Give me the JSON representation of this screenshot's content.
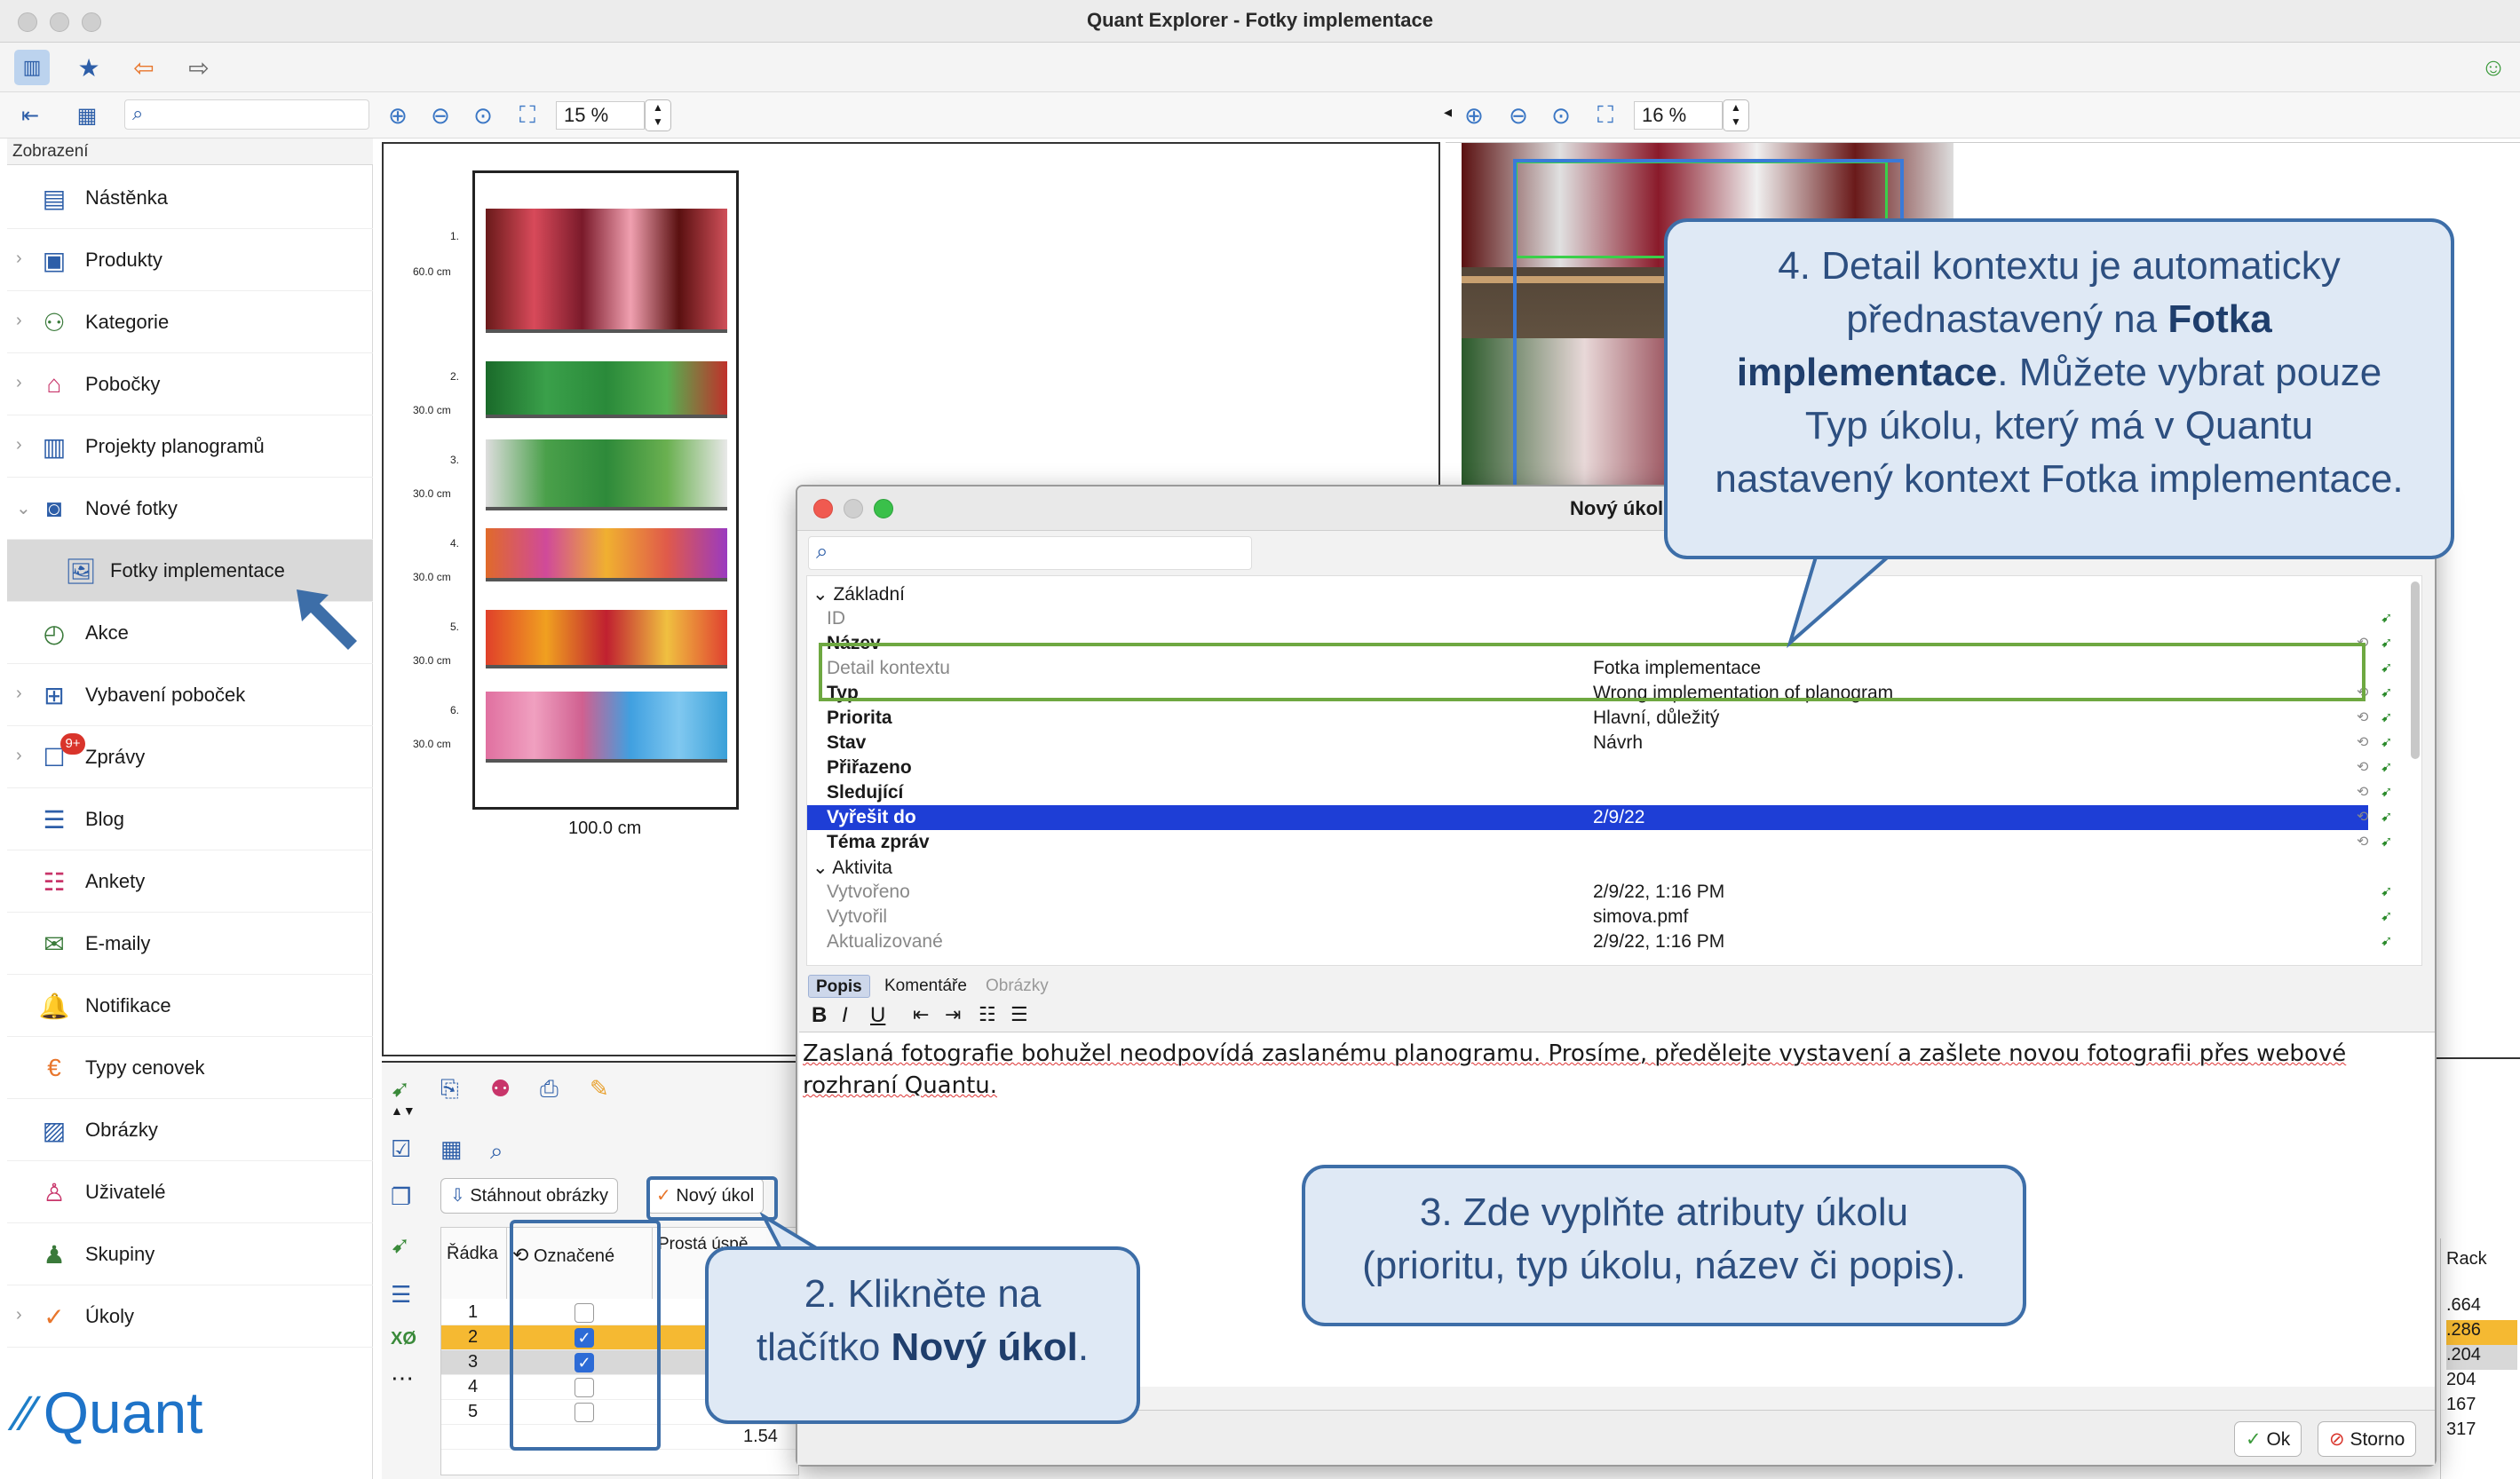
{
  "window": {
    "title": "Quant Explorer - Fotky implementace"
  },
  "left_toolbar": {
    "zoom": "15 %"
  },
  "right_toolbar": {
    "zoom": "16 %"
  },
  "sidebar": {
    "header": "Zobrazení",
    "items": [
      {
        "label": "Nástěnka",
        "icon": "dashboard-icon"
      },
      {
        "label": "Produkty",
        "icon": "product-icon"
      },
      {
        "label": "Kategorie",
        "icon": "category-tree-icon"
      },
      {
        "label": "Pobočky",
        "icon": "store-icon"
      },
      {
        "label": "Projekty planogramů",
        "icon": "planogram-icon"
      },
      {
        "label": "Nové fotky",
        "icon": "camera-icon"
      },
      {
        "label": "Fotky implementace",
        "icon": "photo-icon"
      },
      {
        "label": "Akce",
        "icon": "clock-icon"
      },
      {
        "label": "Vybavení poboček",
        "icon": "equipment-icon"
      },
      {
        "label": "Zprávy",
        "icon": "messages-icon",
        "badge": "9+"
      },
      {
        "label": "Blog",
        "icon": "blog-icon"
      },
      {
        "label": "Ankety",
        "icon": "survey-icon"
      },
      {
        "label": "E-maily",
        "icon": "email-icon"
      },
      {
        "label": "Notifikace",
        "icon": "notification-icon"
      },
      {
        "label": "Typy cenovek",
        "icon": "price-tag-icon"
      },
      {
        "label": "Obrázky",
        "icon": "image-icon"
      },
      {
        "label": "Uživatelé",
        "icon": "user-icon"
      },
      {
        "label": "Skupiny",
        "icon": "group-icon"
      },
      {
        "label": "Úkoly",
        "icon": "task-icon"
      }
    ],
    "logo": "Quant"
  },
  "planogram": {
    "shelves": [
      {
        "num": "1.",
        "height": "60.0 cm"
      },
      {
        "num": "2.",
        "height": "30.0 cm"
      },
      {
        "num": "3.",
        "height": "30.0 cm"
      },
      {
        "num": "4.",
        "height": "30.0 cm"
      },
      {
        "num": "5.",
        "height": "30.0 cm"
      },
      {
        "num": "6.",
        "height": "30.0 cm"
      }
    ],
    "width": "100.0 cm"
  },
  "lower": {
    "download_button": "Stáhnout obrázky",
    "new_task_button": "Nový úkol",
    "columns": {
      "row": "Řádka",
      "marked": "Označené",
      "simple": "Prostá úspě"
    },
    "rows": [
      {
        "n": "1",
        "checked": false
      },
      {
        "n": "2",
        "checked": true
      },
      {
        "n": "3",
        "checked": true
      },
      {
        "n": "4",
        "checked": false
      },
      {
        "n": "5",
        "checked": false
      }
    ],
    "partial_value": "1.54",
    "rack_header": "Rack",
    "rack_values": [
      ".664",
      ".286",
      ".204",
      "204",
      "167",
      "317"
    ]
  },
  "dialog": {
    "title": "Nový úkol",
    "groups": {
      "basic": "Základní",
      "activity": "Aktivita"
    },
    "props": {
      "id": {
        "k": "ID",
        "v": ""
      },
      "name": {
        "k": "Název",
        "v": ""
      },
      "context": {
        "k": "Detail kontextu",
        "v": "Fotka implementace"
      },
      "type": {
        "k": "Typ",
        "v": "Wrong implementation of planogram"
      },
      "priority": {
        "k": "Priorita",
        "v": "Hlavní, důležitý"
      },
      "state": {
        "k": "Stav",
        "v": "Návrh"
      },
      "assigned": {
        "k": "Přiřazeno",
        "v": ""
      },
      "followers": {
        "k": "Sledující",
        "v": ""
      },
      "due": {
        "k": "Vyřešit do",
        "v": "2/9/22"
      },
      "topic": {
        "k": "Téma zpráv",
        "v": ""
      },
      "created": {
        "k": "Vytvořeno",
        "v": "2/9/22, 1:16 PM"
      },
      "author": {
        "k": "Vytvořil",
        "v": "simova.pmf"
      },
      "updated": {
        "k": "Aktualizované",
        "v": "2/9/22, 1:16 PM"
      }
    },
    "tabs": {
      "desc": "Popis",
      "comments": "Komentáře",
      "images": "Obrázky"
    },
    "description": "Zaslaná fotografie bohužel neodpovídá zaslanému planogramu. Prosíme, předělejte vystavení a zašlete novou fotografii přes webové rozhraní Quantu.",
    "ok": "Ok",
    "cancel": "Storno"
  },
  "callouts": {
    "c2_line1": "2. Klikněte na",
    "c2_line2a": "tlačítko ",
    "c2_line2b": "Nový úkol",
    "c2_line2c": ".",
    "c3_line1": "3. Zde vyplňte atributy úkolu",
    "c3_line2": "(prioritu, typ úkolu, název či popis).",
    "c4_line1": "4. Detail kontextu je automaticky",
    "c4_line2a": "přednastavený na ",
    "c4_line2b": "Fotka",
    "c4_line3a": "implementace",
    "c4_line3b": ". Můžete vybrat pouze",
    "c4_line4": "Typ úkolu, který má v Quantu",
    "c4_line5": "nastavený kontext Fotka implementace."
  },
  "colors": {
    "accent": "#3d6ea8",
    "highlight": "#6ea841",
    "selection": "#1e3ed6",
    "row_highlight": "#f5b932"
  }
}
